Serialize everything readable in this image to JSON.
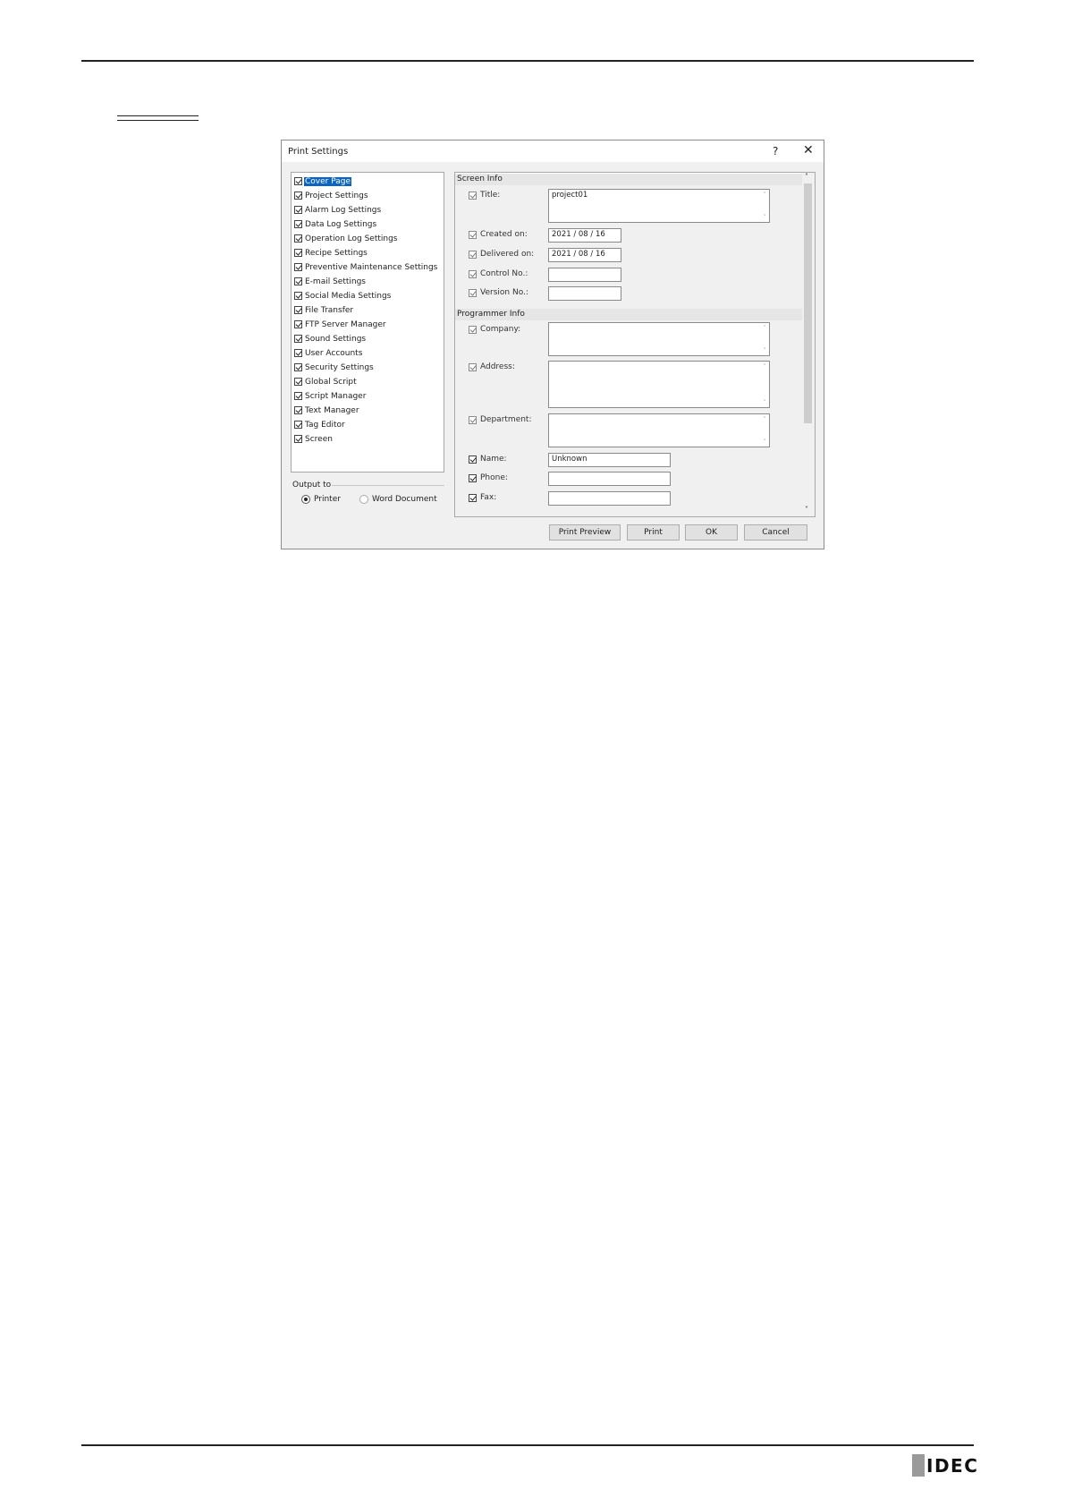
{
  "dialog": {
    "title": "Print Settings",
    "help": "?",
    "close": "✕",
    "tree_items": [
      {
        "label": "Cover Page",
        "checked": true,
        "selected": true
      },
      {
        "label": "Project Settings",
        "checked": true
      },
      {
        "label": "Alarm Log Settings",
        "checked": true
      },
      {
        "label": "Data Log Settings",
        "checked": true
      },
      {
        "label": "Operation Log Settings",
        "checked": true
      },
      {
        "label": "Recipe Settings",
        "checked": true
      },
      {
        "label": "Preventive Maintenance Settings",
        "checked": true
      },
      {
        "label": "E-mail Settings",
        "checked": true
      },
      {
        "label": "Social Media Settings",
        "checked": true
      },
      {
        "label": "File Transfer",
        "checked": true
      },
      {
        "label": "FTP Server Manager",
        "checked": true
      },
      {
        "label": "Sound Settings",
        "checked": true
      },
      {
        "label": "User Accounts",
        "checked": true
      },
      {
        "label": "Security Settings",
        "checked": true
      },
      {
        "label": "Global Script",
        "checked": true
      },
      {
        "label": "Script Manager",
        "checked": true
      },
      {
        "label": "Text Manager",
        "checked": true
      },
      {
        "label": "Tag Editor",
        "checked": true
      },
      {
        "label": "Screen",
        "checked": true
      }
    ],
    "output": {
      "label": "Output to",
      "printer": "Printer",
      "word": "Word Document",
      "selected": "Printer"
    },
    "screen_info": {
      "header": "Screen Info",
      "title_label": "Title:",
      "title_value": "project01",
      "created_label": "Created on:",
      "created_value": "2021 / 08 / 16",
      "delivered_label": "Delivered on:",
      "delivered_value": "2021 / 08 / 16",
      "control_label": "Control No.:",
      "control_value": "",
      "version_label": "Version No.:",
      "version_value": ""
    },
    "programmer_info": {
      "header": "Programmer Info",
      "company_label": "Company:",
      "address_label": "Address:",
      "department_label": "Department:",
      "name_label": "Name:",
      "name_value": "Unknown",
      "phone_label": "Phone:",
      "fax_label": "Fax:"
    },
    "buttons": {
      "print_preview": "Print Preview",
      "print": "Print",
      "ok": "OK",
      "cancel": "Cancel"
    },
    "scroll": {
      "up": "˄",
      "down": "˅"
    }
  },
  "footer": {
    "logo": "IDEC"
  }
}
